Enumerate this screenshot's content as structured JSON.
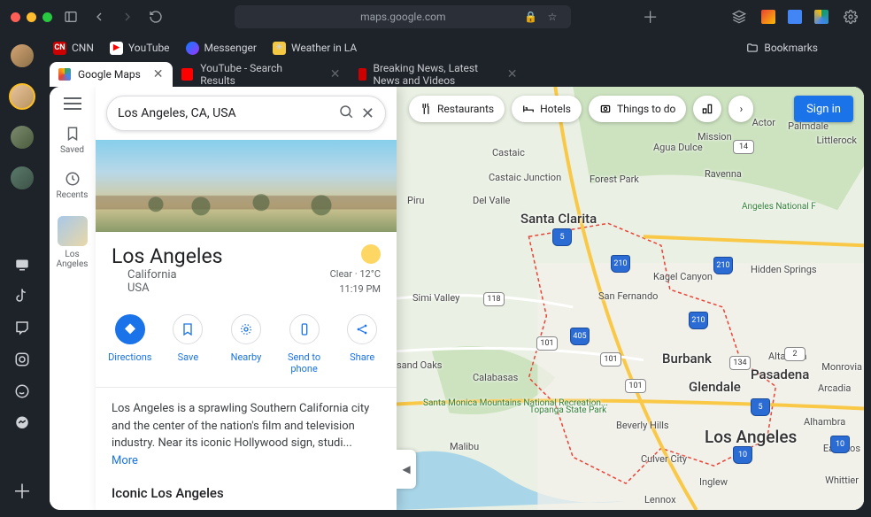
{
  "window": {
    "url": "maps.google.com"
  },
  "bookmarks": {
    "items": [
      {
        "label": "CNN",
        "color": "#cc0000"
      },
      {
        "label": "YouTube",
        "color": "#ff0000"
      },
      {
        "label": "Messenger",
        "color": "#0a7cff"
      },
      {
        "label": "Weather in LA",
        "color": "#f5c842"
      }
    ],
    "right_label": "Bookmarks"
  },
  "tabs": [
    {
      "label": "Google Maps",
      "active": true,
      "fav": "#34a853"
    },
    {
      "label": "YouTube - Search Results",
      "active": false,
      "fav": "#ff0000"
    },
    {
      "label": "Breaking News, Latest News and Videos",
      "active": false,
      "fav": "#cc0000"
    }
  ],
  "maps": {
    "search_value": "Los Angeles, CA, USA",
    "siderail": {
      "saved": "Saved",
      "recents": "Recents",
      "thumb_label": "Los Angeles"
    },
    "place": {
      "title": "Los Angeles",
      "state": "California",
      "country": "USA",
      "weather": "Clear",
      "temp": "12°C",
      "time": "11:19 PM",
      "description": "Los Angeles is a sprawling Southern California city and the center of the nation's film and television industry. Near its iconic Hollywood sign, studi...",
      "more": "More",
      "iconic": "Iconic Los Angeles"
    },
    "actions": {
      "directions": "Directions",
      "save": "Save",
      "nearby": "Nearby",
      "send": "Send to phone",
      "share": "Share"
    },
    "pills": {
      "restaurants": "Restaurants",
      "hotels": "Hotels",
      "things": "Things to do"
    },
    "signin": "Sign in",
    "labels": {
      "palmdale": "Palmdale",
      "actor": "Actor",
      "littlerock": "Littlerock",
      "mission": "Mission",
      "agua_dulce": "Agua Dulce",
      "castaic": "Castaic",
      "castaic_junction": "Castaic Junction",
      "forest_park": "Forest Park",
      "ravenna": "Ravenna",
      "piru": "Piru",
      "del_valle": "Del Valle",
      "santa_clarita": "Santa Clarita",
      "hidden_springs": "Hidden Springs",
      "kagel_canyon": "Kagel Canyon",
      "san_fernando": "San Fernando",
      "simi_valley": "Simi Valley",
      "sand": "sand Oaks",
      "calabasas": "Calabasas",
      "burbank": "Burbank",
      "altadena": "Altadena",
      "pasadena": "Pasadena",
      "glendale": "Glendale",
      "arcadia": "Arcadia",
      "monrovia": "Monrovia",
      "topanga": "Topanga State Park",
      "beverly": "Beverly Hills",
      "los_angeles": "Los Angeles",
      "alhambra": "Alhambra",
      "culver": "Culver City",
      "lennox": "Lennox",
      "inglewood": "Inglew",
      "east_la": "East Los",
      "malibu": "Malibu",
      "whittier": "Whittier",
      "santa_monica": "Santa Monica Mountains National Recreation...",
      "angeles_nf": "Angeles National F"
    },
    "shields": {
      "i5": "5",
      "i210": "210",
      "i405": "405",
      "i10": "10",
      "r101": "101",
      "r118": "118",
      "r134": "134",
      "r14": "14",
      "r2": "2"
    }
  }
}
